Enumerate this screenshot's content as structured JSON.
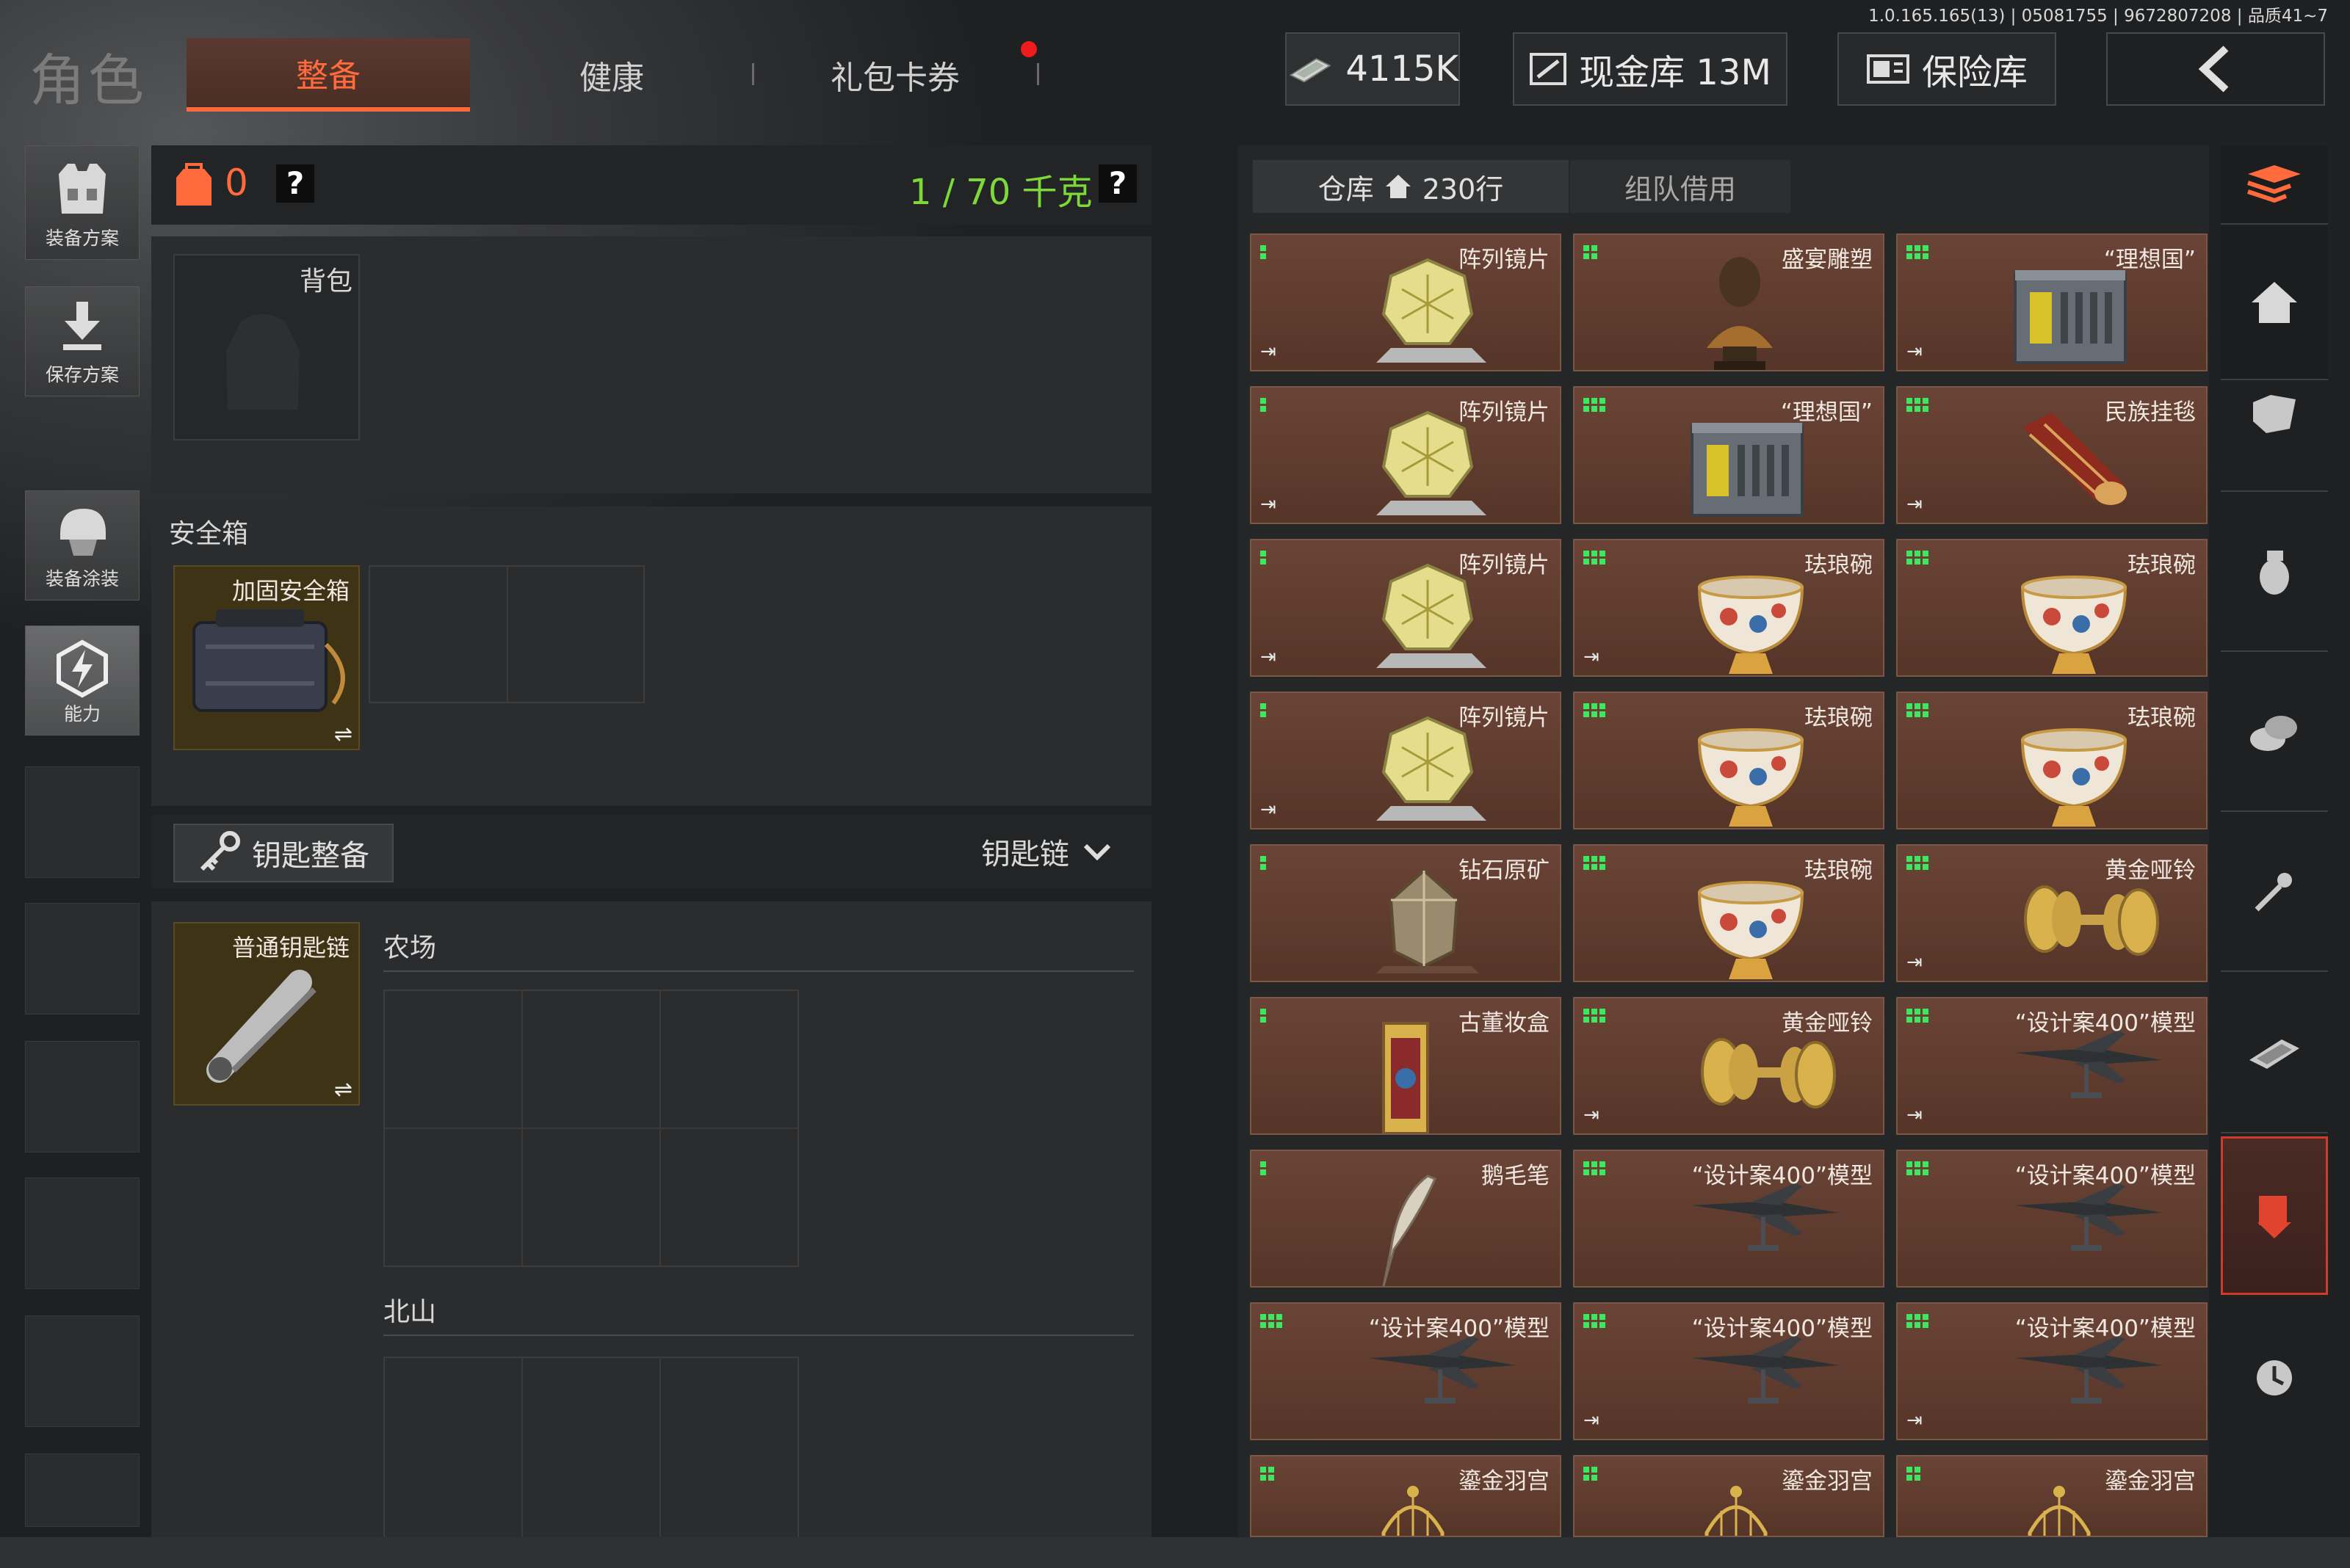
{
  "version_text": "1.0.165.165(13) | 05081755 | 9672807208 | 品质41~7",
  "header": {
    "title": "角色",
    "tabs": [
      "整备",
      "健康",
      "礼包卡券"
    ],
    "currency": "4115K",
    "cash_vault": "现金库 13M",
    "safe_vault": "保险库"
  },
  "left_sidebar": [
    "装备方案",
    "保存方案",
    "装备涂装",
    "能力"
  ],
  "loadout": {
    "carry_count": "0",
    "help": "?",
    "weight": "1 / 70 千克",
    "backpack_label": "背包",
    "safebox_section": "安全箱",
    "safebox_item": "加固安全箱",
    "key_gear_button": "钥匙整备",
    "keychain_label": "钥匙链",
    "keychain_item": "普通钥匙链",
    "area1": "农场",
    "area2": "北山",
    "swap_icon": "⇌"
  },
  "warehouse": {
    "tab_storage": "仓库",
    "rows": "230行",
    "tab_team": "组队借用",
    "items": [
      {
        "name": "阵列镜片",
        "icon": "array-lens",
        "exit": true,
        "q": 1
      },
      {
        "name": "盛宴雕塑",
        "icon": "bust-statue",
        "exit": false,
        "q": 2
      },
      {
        "name": "“理想国”",
        "icon": "utopia-box",
        "exit": true,
        "q": 3
      },
      {
        "name": "阵列镜片",
        "icon": "array-lens",
        "exit": true,
        "q": 1
      },
      {
        "name": "“理想国”",
        "icon": "utopia-box",
        "exit": false,
        "q": 3
      },
      {
        "name": "民族挂毯",
        "icon": "tapestry",
        "exit": true,
        "q": 3
      },
      {
        "name": "阵列镜片",
        "icon": "array-lens",
        "exit": true,
        "q": 1
      },
      {
        "name": "珐琅碗",
        "icon": "enamel-bowl",
        "exit": true,
        "q": 3
      },
      {
        "name": "珐琅碗",
        "icon": "enamel-bowl",
        "exit": false,
        "q": 3
      },
      {
        "name": "阵列镜片",
        "icon": "array-lens",
        "exit": true,
        "q": 1
      },
      {
        "name": "珐琅碗",
        "icon": "enamel-bowl",
        "exit": false,
        "q": 3
      },
      {
        "name": "珐琅碗",
        "icon": "enamel-bowl",
        "exit": false,
        "q": 3
      },
      {
        "name": "钻石原矿",
        "icon": "raw-diamond",
        "exit": false,
        "q": 1
      },
      {
        "name": "珐琅碗",
        "icon": "enamel-bowl",
        "exit": false,
        "q": 3
      },
      {
        "name": "黄金哑铃",
        "icon": "gold-dumbbell",
        "exit": true,
        "q": 3
      },
      {
        "name": "古董妆盒",
        "icon": "antique-box",
        "exit": false,
        "q": 1
      },
      {
        "name": "黄金哑铃",
        "icon": "gold-dumbbell",
        "exit": true,
        "q": 3
      },
      {
        "name": "“设计案400”模型",
        "icon": "jet-model",
        "exit": true,
        "q": 3
      },
      {
        "name": "鹅毛笔",
        "icon": "quill",
        "exit": false,
        "q": 1
      },
      {
        "name": "“设计案400”模型",
        "icon": "jet-model",
        "exit": false,
        "q": 3
      },
      {
        "name": "“设计案400”模型",
        "icon": "jet-model",
        "exit": false,
        "q": 3
      },
      {
        "name": "“设计案400”模型",
        "icon": "jet-model",
        "exit": false,
        "q": 3
      },
      {
        "name": "“设计案400”模型",
        "icon": "jet-model",
        "exit": true,
        "q": 3
      },
      {
        "name": "“设计案400”模型",
        "icon": "jet-model",
        "exit": true,
        "q": 3
      },
      {
        "name": "鎏金羽宫",
        "icon": "gilded-birdcage",
        "exit": false,
        "q": 2
      },
      {
        "name": "鎏金羽宫",
        "icon": "gilded-birdcage",
        "exit": false,
        "q": 2
      },
      {
        "name": "鎏金羽宫",
        "icon": "gilded-birdcage",
        "exit": false,
        "q": 2
      }
    ]
  },
  "right_sidebar": [
    "sort-icon",
    "home-icon",
    "armor-icon",
    "grenade-icon",
    "coins-icon",
    "key-icon",
    "cash-icon",
    "transfer-icon",
    "clock-icon"
  ],
  "colors": {
    "accent": "#ff6b3d",
    "weight": "#7dd93a",
    "quality": "#3de860",
    "item_bg": "#5e3d30"
  }
}
